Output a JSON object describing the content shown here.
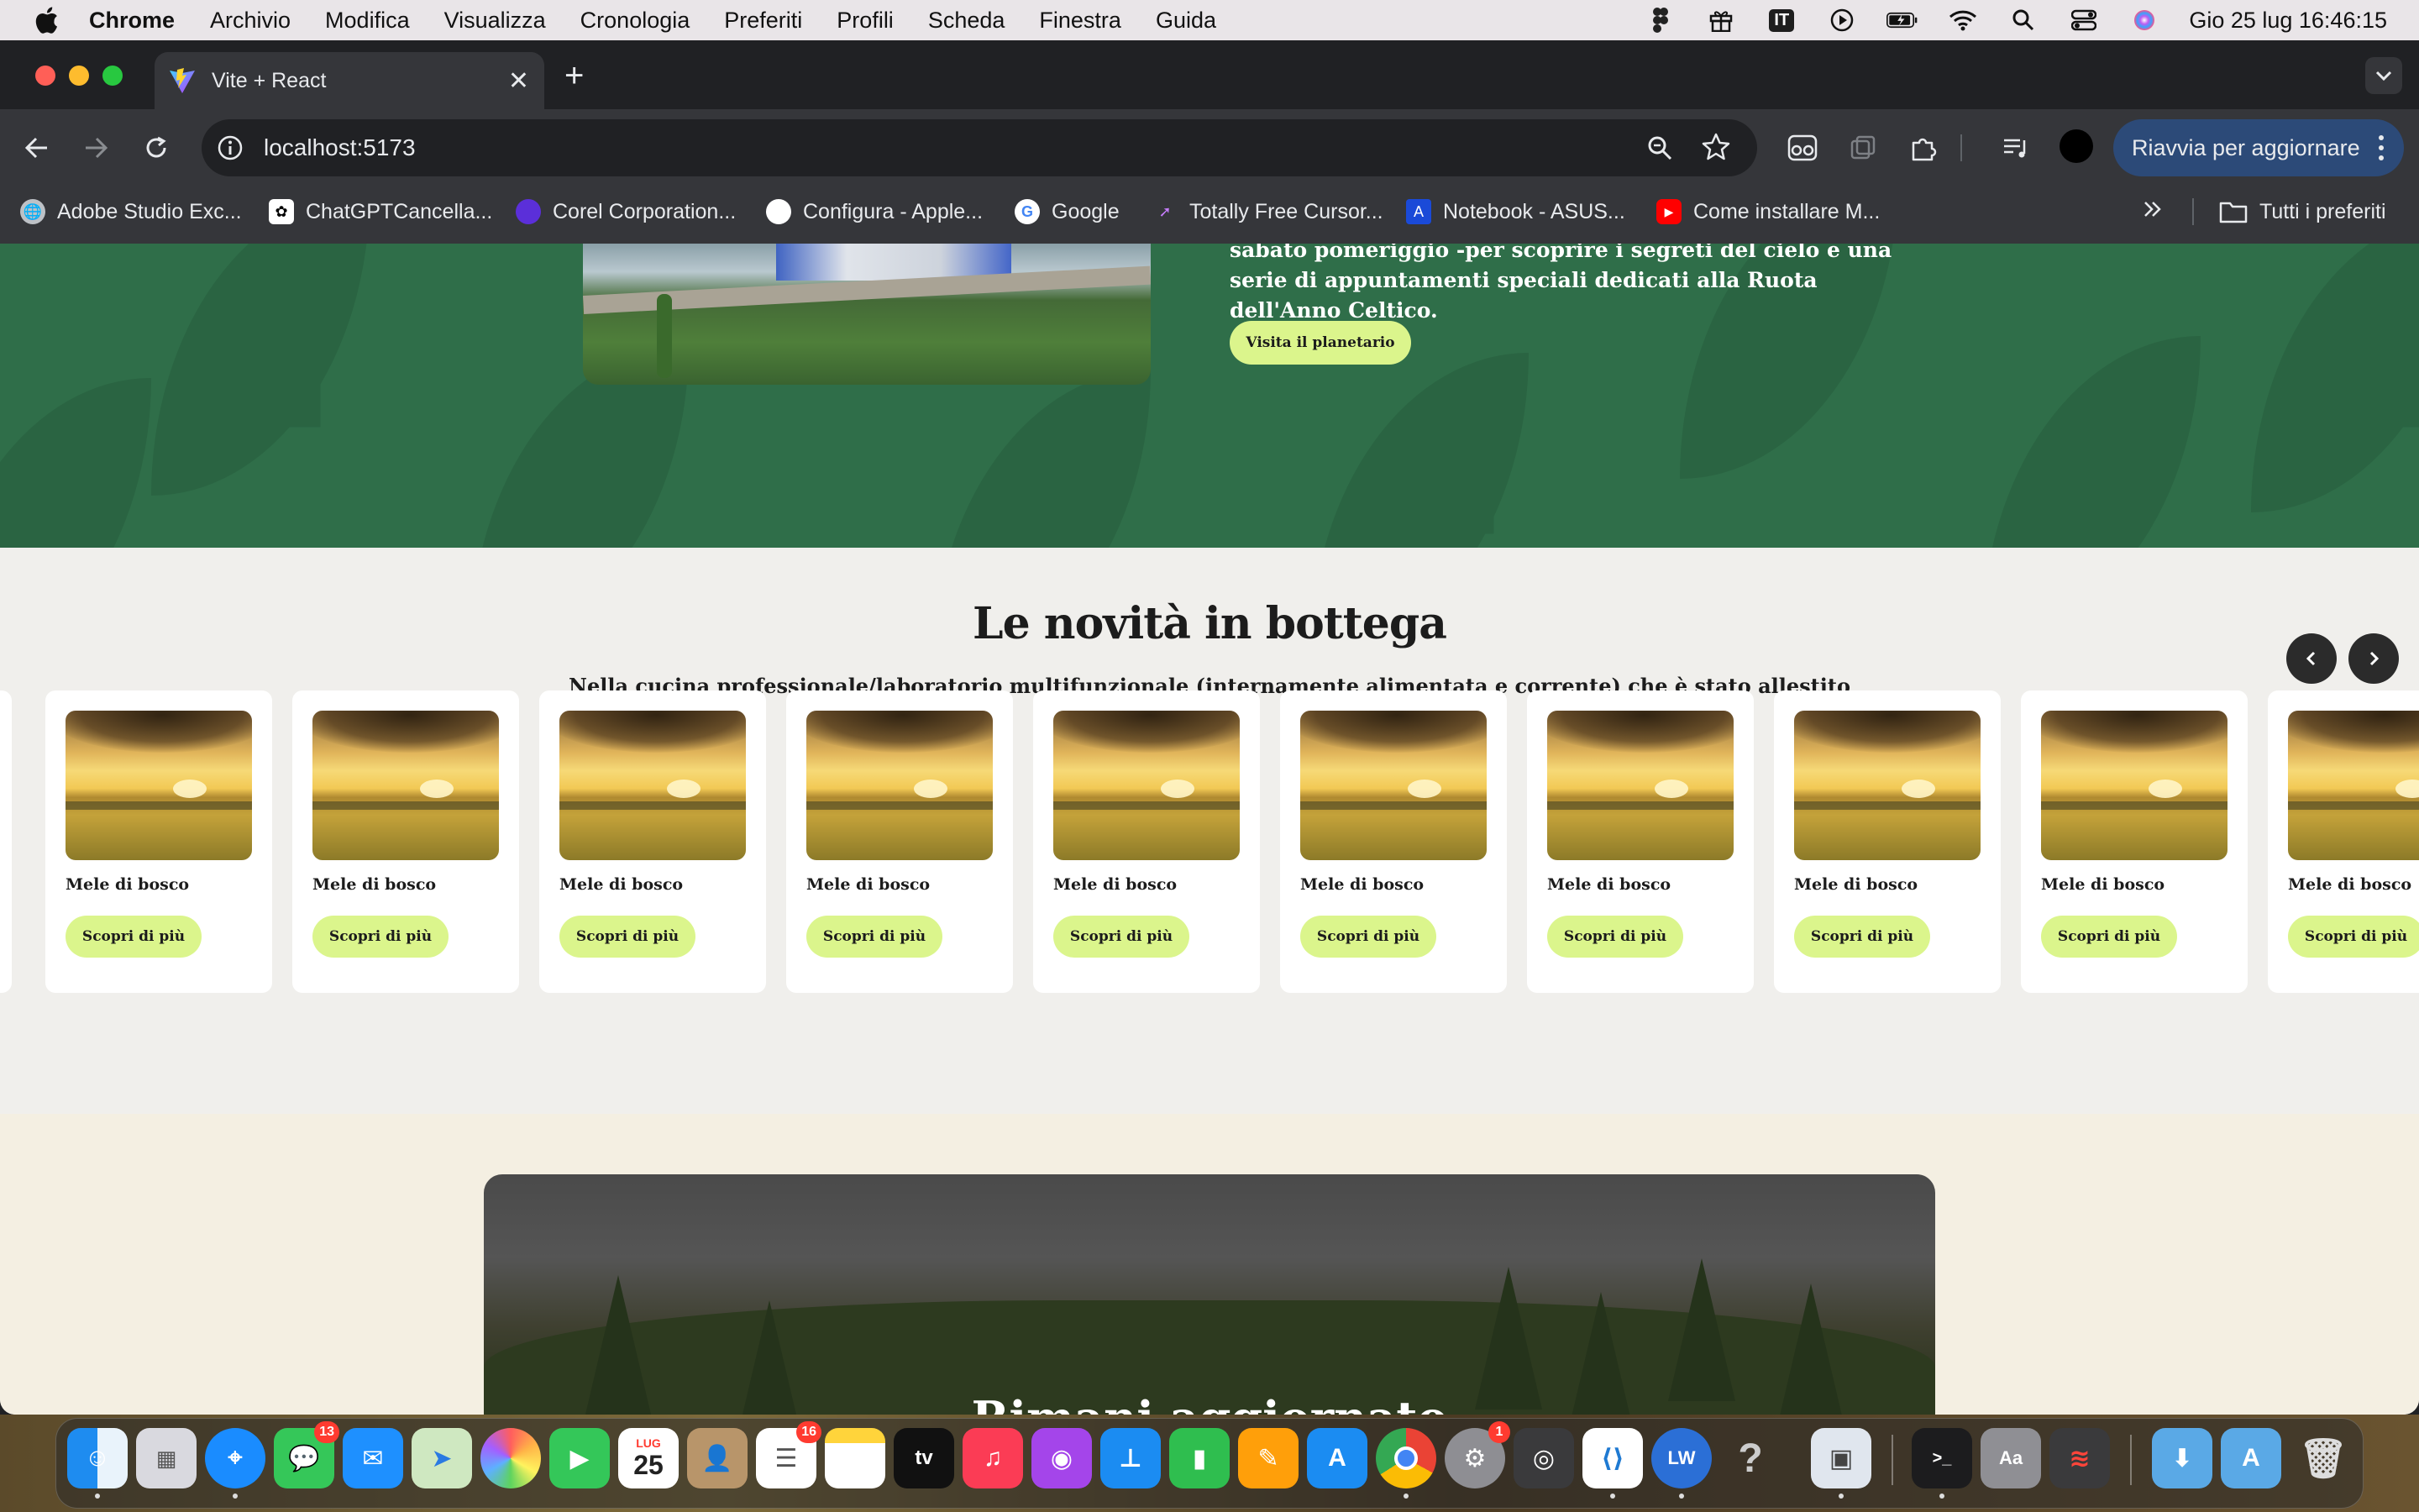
{
  "menubar": {
    "app": "Chrome",
    "items": [
      "Archivio",
      "Modifica",
      "Visualizza",
      "Cronologia",
      "Preferiti",
      "Profili",
      "Scheda",
      "Finestra",
      "Guida"
    ],
    "input_source": "IT",
    "clock": "Gio 25 lug  16:46:15"
  },
  "browser": {
    "tab_title": "Vite + React",
    "url": "localhost:5173",
    "update_button": "Riavvia per aggiornare",
    "bookmarks": [
      "Adobe Studio Exc...",
      "ChatGPTCancella...",
      "Corel Corporation...",
      "Configura - Apple...",
      "Google",
      "Totally Free Cursor...",
      "Notebook - ASUS...",
      "Come installare M..."
    ],
    "all_bookmarks": "Tutti i preferiti"
  },
  "page": {
    "hero": {
      "text": "sabato pomeriggio -per scoprire i segreti del cielo e una serie di appuntamenti speciali dedicati alla Ruota dell'Anno Celtico.",
      "button": "Visita il planetario"
    },
    "novita": {
      "title": "Le novità in bottega",
      "subtitle": "Nella cucina professionale/laboratorio multifunzionale (internamente alimentata e corrente) che è stato allestito",
      "cards": [
        {
          "name": "Mele di bosco",
          "button": "Scopri di più"
        },
        {
          "name": "Mele di bosco",
          "button": "Scopri di più"
        },
        {
          "name": "Mele di bosco",
          "button": "Scopri di più"
        },
        {
          "name": "Mele di bosco",
          "button": "Scopri di più"
        },
        {
          "name": "Mele di bosco",
          "button": "Scopri di più"
        },
        {
          "name": "Mele di bosco",
          "button": "Scopri di più"
        },
        {
          "name": "Mele di bosco",
          "button": "Scopri di più"
        },
        {
          "name": "Mele di bosco",
          "button": "Scopri di più"
        },
        {
          "name": "Mele di bosco",
          "button": "Scopri di più"
        },
        {
          "name": "Mele di bosco",
          "button": "Scopri di più"
        }
      ]
    },
    "newsletter": {
      "title": "Rimani aggiornato"
    }
  },
  "dock": {
    "badges": {
      "messages": "13",
      "reminders": "16",
      "settings": "1"
    },
    "calendar_month": "LUG",
    "calendar_day": "25",
    "tv_label": "tv",
    "lw_label": "LW"
  },
  "colors": {
    "green_section": "#2f6e49",
    "accent_button": "#dbf58c",
    "page_bg": "#f0efec",
    "cream_bg": "#f4efe2"
  }
}
